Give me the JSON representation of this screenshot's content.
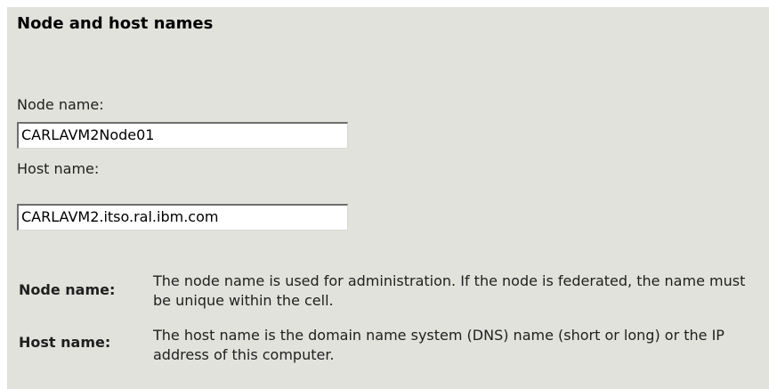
{
  "section": {
    "title": "Node and host names"
  },
  "fields": {
    "node_name": {
      "label": "Node name:",
      "value": "CARLAVM2Node01"
    },
    "host_name": {
      "label": "Host name:",
      "value": "CARLAVM2.itso.ral.ibm.com"
    }
  },
  "help": {
    "node_name": {
      "term": "Node name:",
      "description": "The node name is used for administration. If the node is federated, the name must be unique within the cell."
    },
    "host_name": {
      "term": "Host name:",
      "description": "The host name is the domain name system (DNS) name (short or long) or the IP address of this computer."
    }
  },
  "colors": {
    "panel_background": "#e2e2dc",
    "page_background": "#ffffff",
    "text": "#202020",
    "field_background": "#ffffff"
  }
}
